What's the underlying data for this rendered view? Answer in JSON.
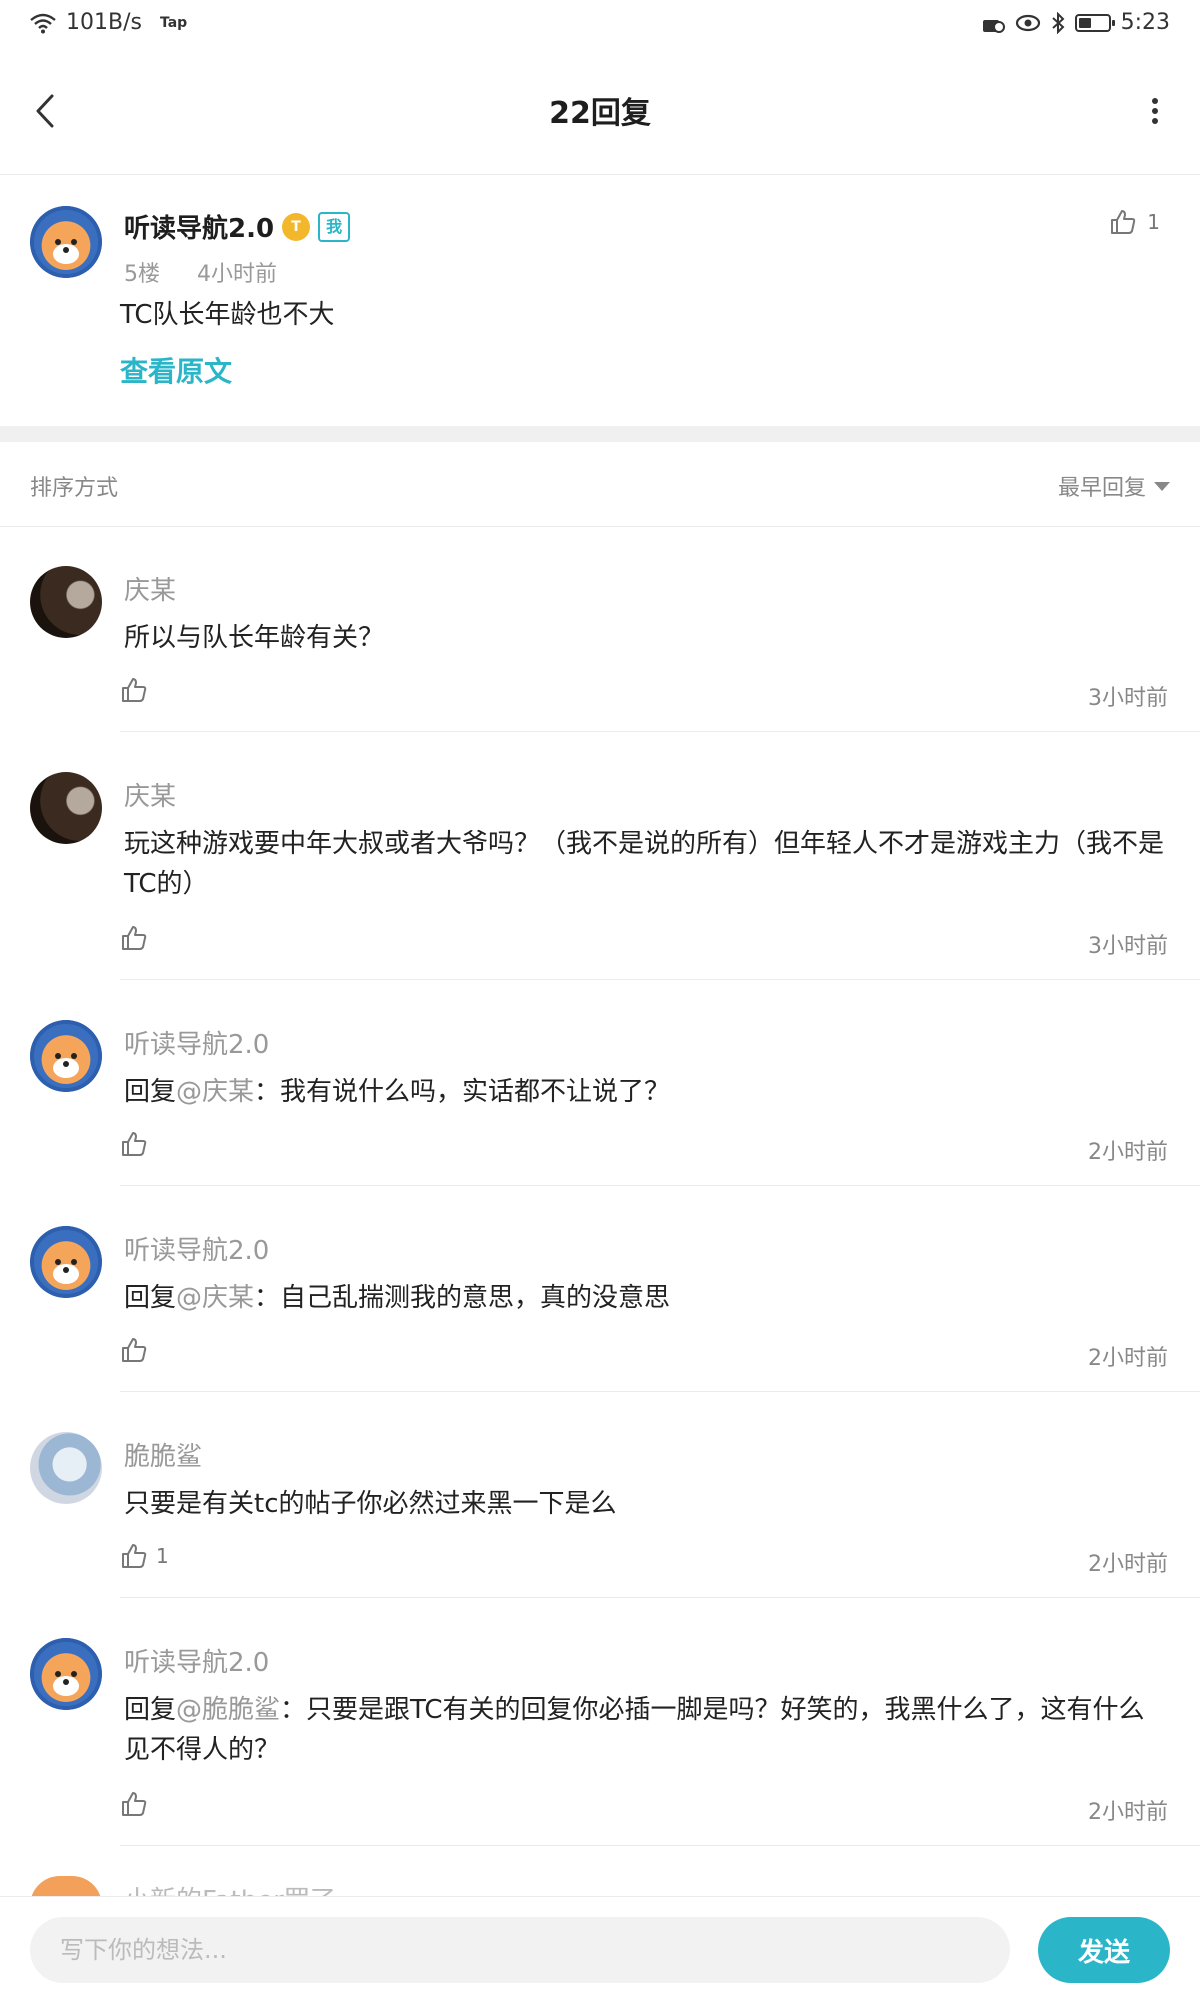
{
  "status_bar": {
    "net_speed": "101B/s",
    "tap_label": "Tap",
    "time": "5:23"
  },
  "header": {
    "title": "22回复",
    "back_icon": "chevron-left-icon",
    "more_icon": "more-vertical-icon"
  },
  "original_post": {
    "author": "听读导航2.0",
    "coin_badge": "T",
    "me_badge": "我",
    "floor": "5楼",
    "time": "4小时前",
    "content": "TC队长年龄也不大",
    "view_original": "查看原文",
    "like_count": "1"
  },
  "sort": {
    "label": "排序方式",
    "value": "最早回复"
  },
  "replies": [
    {
      "author": "庆某",
      "prefix": "",
      "mention": "",
      "content": "所以与队长年龄有关？",
      "likes": "",
      "time": "3小时前"
    },
    {
      "author": "庆某",
      "prefix": "",
      "mention": "",
      "content": "玩这种游戏要中年大叔或者大爷吗？（我不是说的所有）但年轻人不才是游戏主力（我不是TC的）",
      "likes": "",
      "time": "3小时前"
    },
    {
      "author": "听读导航2.0",
      "prefix": "回复",
      "mention": "@庆某",
      "content": "：我有说什么吗，实话都不让说了？",
      "likes": "",
      "time": "2小时前"
    },
    {
      "author": "听读导航2.0",
      "prefix": "回复",
      "mention": "@庆某",
      "content": "：自己乱揣测我的意思，真的没意思",
      "likes": "",
      "time": "2小时前"
    },
    {
      "author": "脆脆鲨",
      "prefix": "",
      "mention": "",
      "content": "只要是有关tc的帖子你必然过来黑一下是么",
      "likes": "1",
      "time": "2小时前"
    },
    {
      "author": "听读导航2.0",
      "prefix": "回复",
      "mention": "@脆脆鲨",
      "content": "：只要是跟TC有关的回复你必插一脚是吗？好笑的，我黑什么了，这有什么见不得人的？",
      "likes": "",
      "time": "2小时前"
    }
  ],
  "peek_author": "小新的Father罢了",
  "composer": {
    "placeholder": "写下你的想法...",
    "send_label": "发送"
  },
  "colors": {
    "accent": "#2bb5c8",
    "muted": "#999999"
  }
}
